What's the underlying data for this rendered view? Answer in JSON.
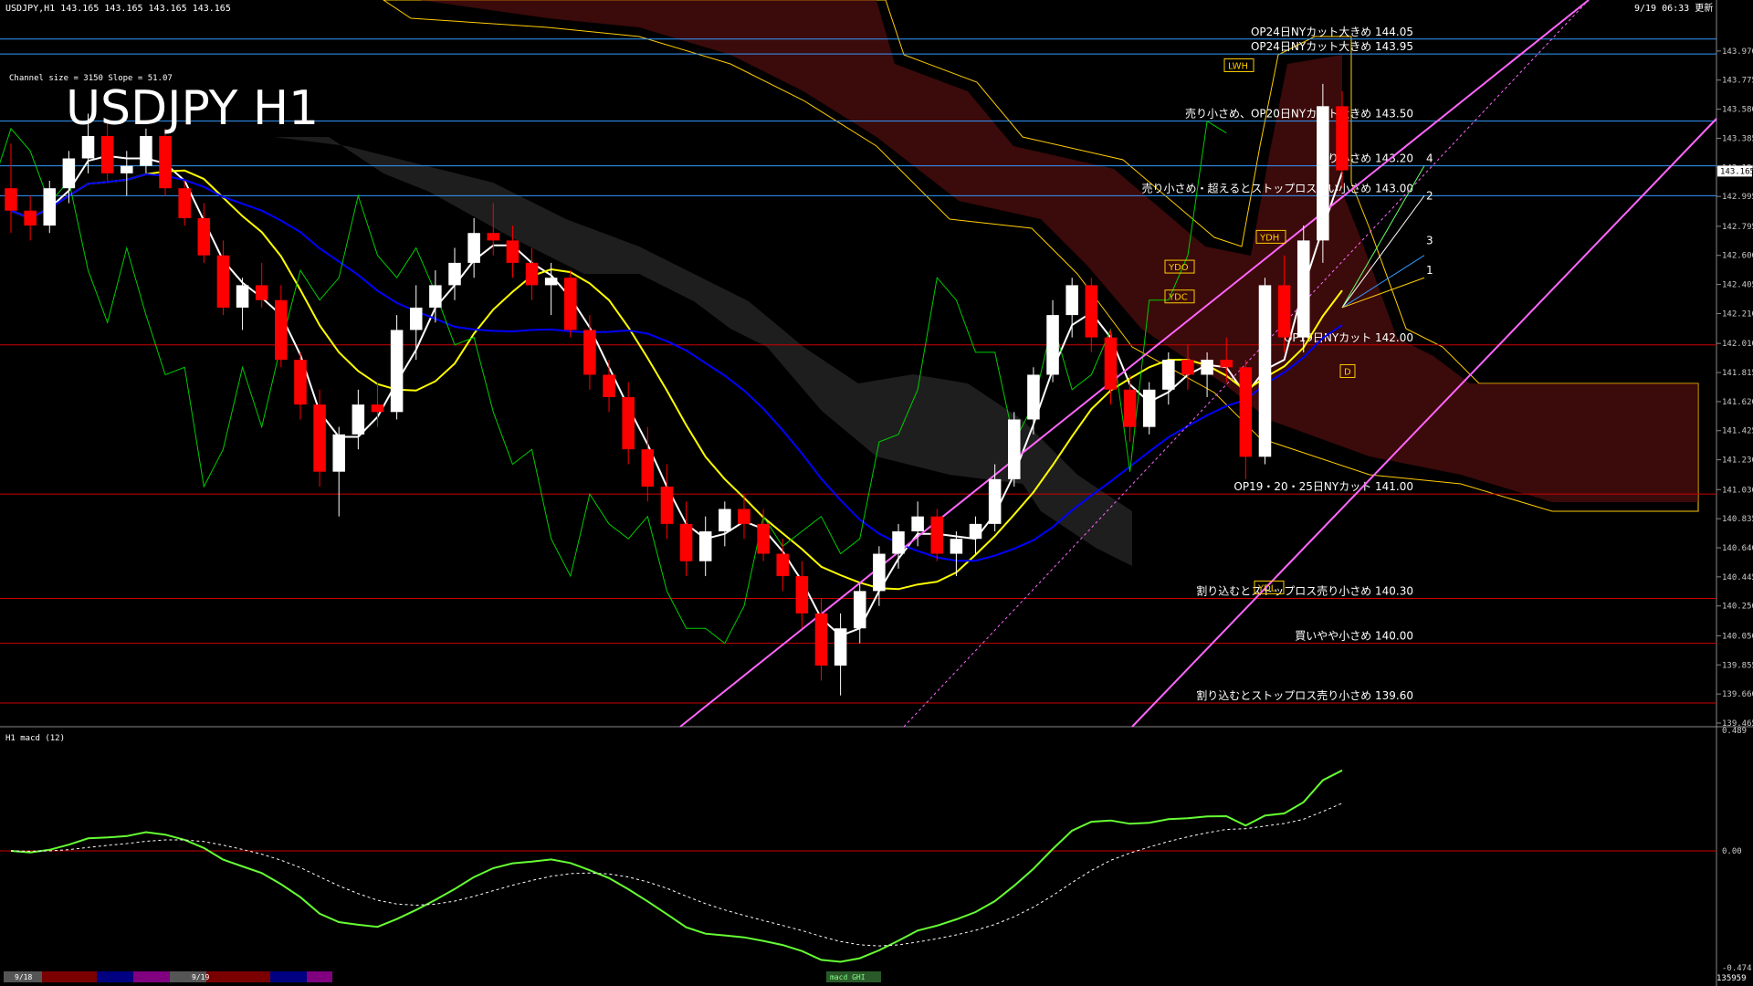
{
  "window": {
    "header_text": "USDJPY,H1  143.165 143.165 143.165 143.165",
    "datetime_text": "9/19 06:33 更新",
    "channel_info": "Channel size = 3150  Slope = 51.07",
    "symbol_title": "USDJPY H1",
    "macd_label": "H1  macd (12)",
    "bottom_timestamp": "135959",
    "macd_tab": "macd GHI"
  },
  "colors": {
    "background": "#000000",
    "cloud": "#8b1a1a",
    "bull_candle": "#ffffff",
    "bear_candle": "#ff0000",
    "ma_fast": "#ffffff",
    "ma_mid": "#ffff00",
    "ma_slow": "#0000ff",
    "channel": "#ff66ff",
    "chikou": "#00cc00",
    "level_red": "#cc0000",
    "level_blue": "#3399ff",
    "macd_up": "#66ff33",
    "macd_down": "#ff88aa"
  },
  "chart_data": [
    {
      "type": "line",
      "panel": "price",
      "symbol": "USDJPY",
      "timeframe": "H1",
      "ylim": [
        139.465,
        144.165
      ],
      "y_ticks": [
        "143.970",
        "143.775",
        "143.580",
        "143.385",
        "143.190",
        "142.995",
        "142.795",
        "142.600",
        "142.405",
        "142.210",
        "142.010",
        "141.815",
        "141.620",
        "141.425",
        "141.230",
        "141.030",
        "140.835",
        "140.640",
        "140.445",
        "140.250",
        "140.050",
        "139.855",
        "139.660",
        "139.465"
      ],
      "current_price": "143.165",
      "horizontal_levels": [
        {
          "value": 144.05,
          "label": "OP24日NYカット大きめ 144.05",
          "color": "#3399ff"
        },
        {
          "value": 143.95,
          "label": "OP24日NYカット大きめ 143.95",
          "color": "#3399ff"
        },
        {
          "value": 143.5,
          "label": "売り小さめ、OP20日NYカット大きめ 143.50",
          "color": "#3399ff"
        },
        {
          "value": 143.2,
          "label": "売り小さめ 143.20",
          "color": "#3399ff"
        },
        {
          "value": 143.0,
          "label": "売り小さめ・超えるとストップロス買い小さめ 143.00",
          "color": "#3399ff"
        },
        {
          "value": 142.0,
          "label": "OP19日NYカット 142.00",
          "color": "#cc0000"
        },
        {
          "value": 141.0,
          "label": "OP19・20・25日NYカット 141.00",
          "color": "#cc0000"
        },
        {
          "value": 140.3,
          "label": "割り込むとストップロス売り小さめ 140.30",
          "color": "#cc0000"
        },
        {
          "value": 140.0,
          "label": "買いやや小さめ 140.00",
          "color": "#cc0000"
        },
        {
          "value": 139.6,
          "label": "割り込むとストップロス売り小さめ 139.60",
          "color": "#cc0000"
        }
      ],
      "markers": [
        "LWH",
        "YDH",
        "YDO",
        "YDC",
        "YDL",
        "D"
      ],
      "fan_labels": [
        "4",
        "2",
        "3",
        "1"
      ],
      "candles": [
        [
          143.05,
          143.35,
          142.75,
          142.9
        ],
        [
          142.9,
          143.0,
          142.7,
          142.8
        ],
        [
          142.8,
          143.1,
          142.75,
          143.05
        ],
        [
          143.05,
          143.3,
          142.95,
          143.25
        ],
        [
          143.25,
          143.55,
          143.15,
          143.4
        ],
        [
          143.4,
          143.5,
          143.1,
          143.15
        ],
        [
          143.15,
          143.3,
          143.0,
          143.2
        ],
        [
          143.2,
          143.45,
          143.15,
          143.4
        ],
        [
          143.4,
          143.45,
          143.0,
          143.05
        ],
        [
          143.05,
          143.1,
          142.8,
          142.85
        ],
        [
          142.85,
          142.95,
          142.55,
          142.6
        ],
        [
          142.6,
          142.7,
          142.2,
          142.25
        ],
        [
          142.25,
          142.45,
          142.1,
          142.4
        ],
        [
          142.4,
          142.55,
          142.25,
          142.3
        ],
        [
          142.3,
          142.4,
          141.85,
          141.9
        ],
        [
          141.9,
          141.95,
          141.5,
          141.6
        ],
        [
          141.6,
          141.7,
          141.05,
          141.15
        ],
        [
          141.15,
          141.45,
          140.85,
          141.4
        ],
        [
          141.4,
          141.7,
          141.3,
          141.6
        ],
        [
          141.6,
          141.75,
          141.45,
          141.55
        ],
        [
          141.55,
          142.2,
          141.5,
          142.1
        ],
        [
          142.1,
          142.4,
          141.9,
          142.25
        ],
        [
          142.25,
          142.5,
          142.15,
          142.4
        ],
        [
          142.4,
          142.65,
          142.3,
          142.55
        ],
        [
          142.55,
          142.85,
          142.45,
          142.75
        ],
        [
          142.75,
          142.95,
          142.6,
          142.7
        ],
        [
          142.7,
          142.8,
          142.45,
          142.55
        ],
        [
          142.55,
          142.65,
          142.3,
          142.4
        ],
        [
          142.4,
          142.55,
          142.2,
          142.45
        ],
        [
          142.45,
          142.5,
          142.05,
          142.1
        ],
        [
          142.1,
          142.2,
          141.7,
          141.8
        ],
        [
          141.8,
          141.9,
          141.55,
          141.65
        ],
        [
          141.65,
          141.75,
          141.2,
          141.3
        ],
        [
          141.3,
          141.45,
          140.95,
          141.05
        ],
        [
          141.05,
          141.2,
          140.7,
          140.8
        ],
        [
          140.8,
          140.95,
          140.45,
          140.55
        ],
        [
          140.55,
          140.85,
          140.45,
          140.75
        ],
        [
          140.75,
          140.95,
          140.65,
          140.9
        ],
        [
          140.9,
          141.0,
          140.7,
          140.8
        ],
        [
          140.8,
          140.9,
          140.55,
          140.6
        ],
        [
          140.6,
          140.7,
          140.35,
          140.45
        ],
        [
          140.45,
          140.55,
          140.1,
          140.2
        ],
        [
          140.2,
          140.3,
          139.75,
          139.85
        ],
        [
          139.85,
          140.2,
          139.65,
          140.1
        ],
        [
          140.1,
          140.4,
          140.0,
          140.35
        ],
        [
          140.35,
          140.65,
          140.25,
          140.6
        ],
        [
          140.6,
          140.8,
          140.5,
          140.75
        ],
        [
          140.75,
          140.95,
          140.65,
          140.85
        ],
        [
          140.85,
          140.9,
          140.55,
          140.6
        ],
        [
          140.6,
          140.75,
          140.45,
          140.7
        ],
        [
          140.7,
          140.85,
          140.6,
          140.8
        ],
        [
          140.8,
          141.2,
          140.75,
          141.1
        ],
        [
          141.1,
          141.55,
          141.05,
          141.5
        ],
        [
          141.5,
          141.85,
          141.4,
          141.8
        ],
        [
          141.8,
          142.3,
          141.75,
          142.2
        ],
        [
          142.2,
          142.45,
          142.05,
          142.4
        ],
        [
          142.4,
          142.45,
          141.95,
          142.05
        ],
        [
          142.05,
          142.1,
          141.6,
          141.7
        ],
        [
          141.7,
          141.8,
          141.35,
          141.45
        ],
        [
          141.45,
          141.75,
          141.4,
          141.7
        ],
        [
          141.7,
          141.95,
          141.6,
          141.9
        ],
        [
          141.9,
          142.0,
          141.7,
          141.8
        ],
        [
          141.8,
          141.95,
          141.65,
          141.9
        ],
        [
          141.9,
          142.05,
          141.75,
          141.85
        ],
        [
          141.85,
          141.9,
          141.1,
          141.25
        ],
        [
          141.25,
          142.45,
          141.2,
          142.4
        ],
        [
          142.4,
          142.6,
          141.95,
          142.05
        ],
        [
          142.05,
          142.8,
          141.95,
          142.7
        ],
        [
          142.7,
          143.75,
          142.55,
          143.6
        ],
        [
          143.6,
          143.7,
          143.05,
          143.17
        ]
      ]
    },
    {
      "type": "line",
      "panel": "macd",
      "name": "macd (12)",
      "ylim": [
        -0.474,
        0.489
      ],
      "y_ticks": [
        "0.489",
        "0.00",
        "-0.474"
      ]
    }
  ],
  "date_tabs": [
    "9/18",
    "9/19"
  ]
}
